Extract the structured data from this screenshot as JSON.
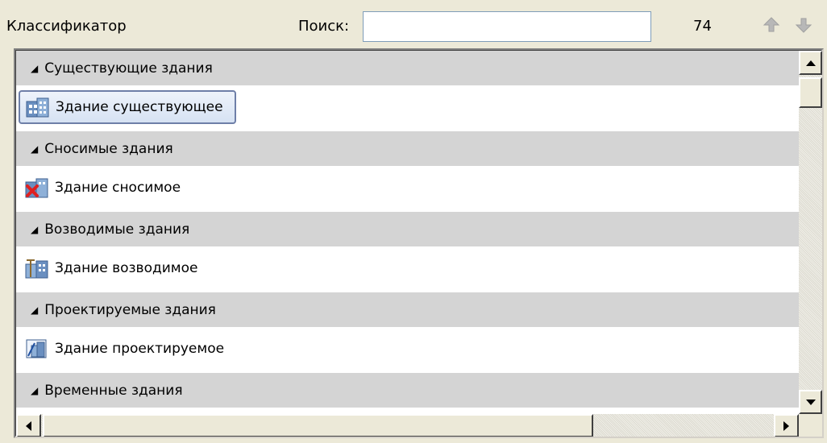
{
  "toolbar": {
    "title": "Классификатор",
    "search_label": "Поиск:",
    "search_value": "",
    "search_placeholder": "",
    "count": "74",
    "up_icon": "arrow-up-icon",
    "down_icon": "arrow-down-icon"
  },
  "groups": [
    {
      "header": "Существующие здания",
      "item": "Здание существующее",
      "icon": "existing-building-icon",
      "selected": true
    },
    {
      "header": "Сносимые здания",
      "item": "Здание сносимое",
      "icon": "demolished-building-icon",
      "selected": false
    },
    {
      "header": "Возводимые здания",
      "item": "Здание возводимое",
      "icon": "building-under-construction-icon",
      "selected": false
    },
    {
      "header": "Проектируемые здания",
      "item": "Здание проектируемое",
      "icon": "projected-building-icon",
      "selected": false
    },
    {
      "header": "Временные здания"
    }
  ],
  "colors": {
    "header_bg": "#d4d4d4",
    "selection_border": "#6e7fa8",
    "window_bg": "#ece9d8"
  }
}
